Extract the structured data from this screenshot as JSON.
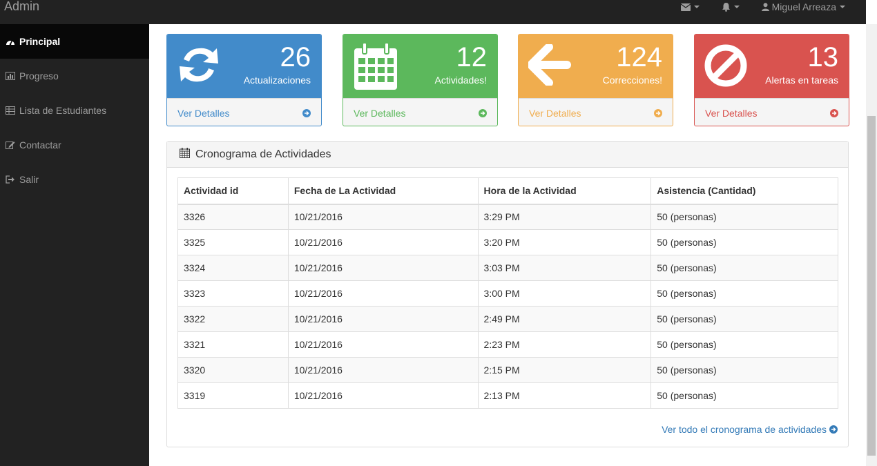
{
  "navbar": {
    "brand": "Admin",
    "user": "Miguel Arreaza",
    "mail_icon": "envelope-icon",
    "bell_icon": "bell-icon",
    "user_icon": "user-icon"
  },
  "sidebar": {
    "items": [
      {
        "label": "Principal",
        "icon": "dashboard-icon",
        "active": true
      },
      {
        "label": "Progreso",
        "icon": "bar-chart-icon"
      },
      {
        "label": "Lista de Estudiantes",
        "icon": "table-icon"
      },
      {
        "label": "Contactar",
        "icon": "edit-icon"
      },
      {
        "label": "Salir",
        "icon": "sign-out-icon"
      }
    ]
  },
  "panels": [
    {
      "number": "26",
      "label": "Actualizaciones",
      "link": "Ver Detalles",
      "color": "#428bca",
      "icon": "refresh-icon"
    },
    {
      "number": "12",
      "label": "Actividades!",
      "link": "Ver Detalles",
      "color": "#5cb85c",
      "icon": "calendar-icon"
    },
    {
      "number": "124",
      "label": "Correcciones!",
      "link": "Ver Detalles",
      "color": "#f0ad4e",
      "icon": "arrow-left-icon"
    },
    {
      "number": "13",
      "label": "Alertas en tareas",
      "link": "Ver Detalles",
      "color": "#d9534f",
      "icon": "ban-icon"
    }
  ],
  "activities": {
    "title": "Cronograma de Actividades",
    "columns": [
      "Actividad id",
      "Fecha de La Actividad",
      "Hora de la Actividad",
      "Asistencia (Cantidad)"
    ],
    "rows": [
      [
        "3326",
        "10/21/2016",
        "3:29 PM",
        "50 (personas)"
      ],
      [
        "3325",
        "10/21/2016",
        "3:20 PM",
        "50 (personas)"
      ],
      [
        "3324",
        "10/21/2016",
        "3:03 PM",
        "50 (personas)"
      ],
      [
        "3323",
        "10/21/2016",
        "3:00 PM",
        "50 (personas)"
      ],
      [
        "3322",
        "10/21/2016",
        "2:49 PM",
        "50 (personas)"
      ],
      [
        "3321",
        "10/21/2016",
        "2:23 PM",
        "50 (personas)"
      ],
      [
        "3320",
        "10/21/2016",
        "2:15 PM",
        "50 (personas)"
      ],
      [
        "3319",
        "10/21/2016",
        "2:13 PM",
        "50 (personas)"
      ]
    ],
    "view_all": "Ver todo el cronograma de actividades"
  }
}
